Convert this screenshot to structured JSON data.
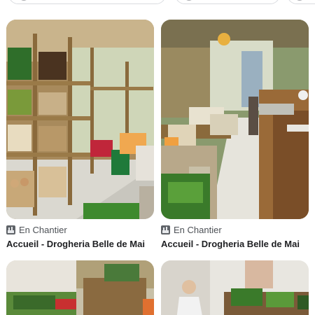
{
  "results": [
    {
      "source": "En Chantier",
      "title": "Accueil - Drogheria Belle de Mai",
      "favicon": "construction-site-favicon",
      "image": "shop-shelves-with-vegetable-crates"
    },
    {
      "source": "En Chantier",
      "title": "Accueil - Drogheria Belle de Mai",
      "favicon": "construction-site-favicon",
      "image": "shop-aisle-with-counters"
    }
  ],
  "partial_results": [
    {
      "image": "vegetable-crates-on-tables"
    },
    {
      "image": "person-arranging-produce"
    }
  ],
  "colors": {
    "text_primary": "#202124",
    "text_secondary": "#4d5156",
    "chip_border": "#dadce0"
  }
}
